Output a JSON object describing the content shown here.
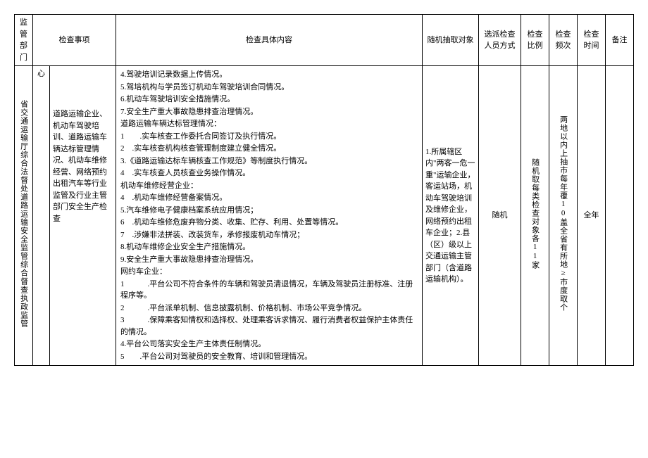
{
  "headers": {
    "dept": "监管部门",
    "matter": "检查事项",
    "content": "检查具体内容",
    "target": "随机抽取对象",
    "method": "选派检查人员方式",
    "ratio": "检查比例",
    "freq": "检查频次",
    "time": "检查时间",
    "note": "备注"
  },
  "row": {
    "dept": "省交通运输厅综合法督处道路运输安全监管综合督查执政监管",
    "center": "心",
    "matter": "道路运输企业、机动车驾驶培训、道路运输车辆达标管理情况、机动车维修经营、网络预约出租汽车等行业监管及行业主管部门安全生产检查",
    "content_lines": [
      "4.驾驶培训记录数据上传情况。",
      "5.驾培机构与学员签订机动车驾驶培训合同情况。",
      "6.机动车驾驶培训安全措施情况。",
      "7.安全生产重大事故隐患排查治理情况。",
      "道路运输车辆达标管理情况：",
      "1　　.实车核查工作委托合同签订及执行情况。",
      "2　.实车核查机构核查管理制度建立健全情况。",
      "3.《道路运输达标车辆核查工作规范》等制度执行情况。",
      "4　.实车核查人员核查业务操作情况。",
      "机动车维修经营企业：",
      "4　.机动车维修经营备案情况。",
      "5.汽车维修电子健康档案系统应用情况；",
      "6　.机动车维修危废弃物分类、收集、贮存、利用、处置等情况。",
      "7　.涉嫌非法拼装、改装货车，承修报废机动车情况；",
      "8.机动车维修企业安全生产措施情况。",
      "9.安全生产重大事故隐患排查治理情况。",
      "网约车企业：",
      "1　　　.平台公司不符合条件的车辆和驾驶员清退情况，车辆及驾驶员注册标准、注册程序等。",
      "2　　　.平台派单机制、信息披露机制、价格机制、市场公平竞争情况。",
      "3　　　.保障乘客知情权和选择权、处理乘客诉求情况、履行消费者权益保护主体责任的情况。",
      "4.平台公司落实安全生产主体责任制情况。",
      "5　　.平台公司对驾驶员的安全教育、培训和管理情况。"
    ],
    "target": "1.所属辖区内\"两客一危一重\"运输企业，客运站场，机动车驾驶培训及维修企业，网络预约出租车企业；2.县（区）级以上交通运输主管部门（含道路运输机构）。",
    "method": "随机",
    "ratio": "随机取每类检查对象各11家",
    "freq": "两地以内上抽市每年覆10盖全省有所地≥市度取个",
    "time": "全年",
    "note": ""
  }
}
